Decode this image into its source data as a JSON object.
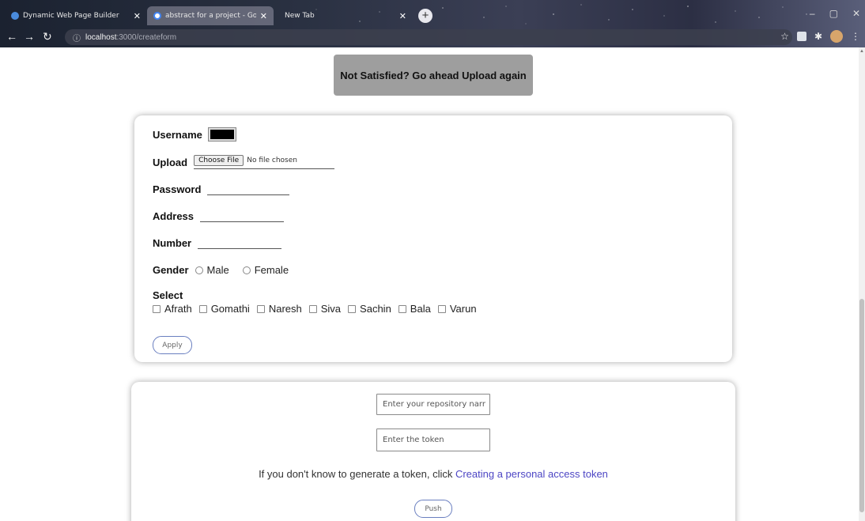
{
  "browser": {
    "tabs": [
      {
        "title": "Dynamic Web Page Builder",
        "favicon_color": "#4a8bdc"
      },
      {
        "title": "abstract for a project - Google S",
        "favicon_color": "#4285f4"
      },
      {
        "title": "New Tab",
        "favicon_color": ""
      }
    ],
    "url_host": "localhost",
    "url_path": ":3000/createform"
  },
  "banner": {
    "label": "Not Satisfied? Go ahead Upload again"
  },
  "form": {
    "username_label": "Username",
    "upload_label": "Upload",
    "choose_file_label": "Choose File",
    "no_file_text": "No file chosen",
    "password_label": "Password",
    "address_label": "Address",
    "number_label": "Number",
    "gender_label": "Gender",
    "gender_options": [
      "Male",
      "Female"
    ],
    "select_label": "Select",
    "select_options": [
      "Afrath",
      "Gomathi",
      "Naresh",
      "Siva",
      "Sachin",
      "Bala",
      "Varun"
    ],
    "apply_label": "Apply",
    "username_color": "#000000"
  },
  "repo": {
    "repo_placeholder": "Enter your repository narr",
    "token_placeholder": "Enter the token",
    "hint_text": "If you don't know to generate a token, click",
    "hint_link": "Creating a personal access token",
    "push_label": "Push"
  }
}
